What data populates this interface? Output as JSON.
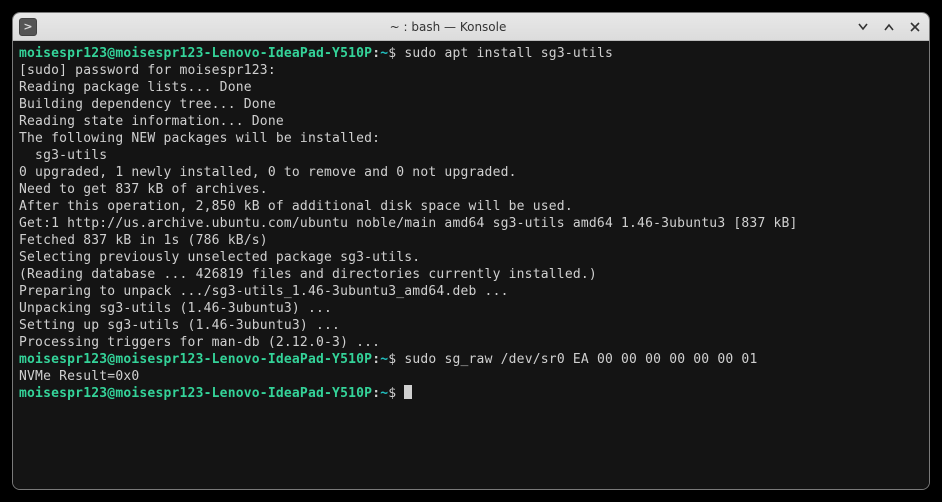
{
  "window": {
    "title": "~ : bash — Konsole",
    "appicon_glyph": ">"
  },
  "prompt": {
    "user_host": "moisespr123@moisespr123-Lenovo-IdeaPad-Y510P",
    "path": "~",
    "symbol": "$"
  },
  "commands": {
    "cmd1": "sudo apt install sg3-utils",
    "cmd2": "sudo sg_raw /dev/sr0 EA 00 00 00 00 00 00 01"
  },
  "output": {
    "lines1": [
      "[sudo] password for moisespr123:",
      "Reading package lists... Done",
      "Building dependency tree... Done",
      "Reading state information... Done",
      "The following NEW packages will be installed:",
      "  sg3-utils",
      "0 upgraded, 1 newly installed, 0 to remove and 0 not upgraded.",
      "Need to get 837 kB of archives.",
      "After this operation, 2,850 kB of additional disk space will be used.",
      "Get:1 http://us.archive.ubuntu.com/ubuntu noble/main amd64 sg3-utils amd64 1.46-3ubuntu3 [837 kB]",
      "Fetched 837 kB in 1s (786 kB/s)",
      "Selecting previously unselected package sg3-utils.",
      "(Reading database ... 426819 files and directories currently installed.)",
      "Preparing to unpack .../sg3-utils_1.46-3ubuntu3_amd64.deb ...",
      "Unpacking sg3-utils (1.46-3ubuntu3) ...",
      "Setting up sg3-utils (1.46-3ubuntu3) ...",
      "Processing triggers for man-db (2.12.0-3) ..."
    ],
    "lines2": [
      "NVMe Result=0x0"
    ]
  }
}
